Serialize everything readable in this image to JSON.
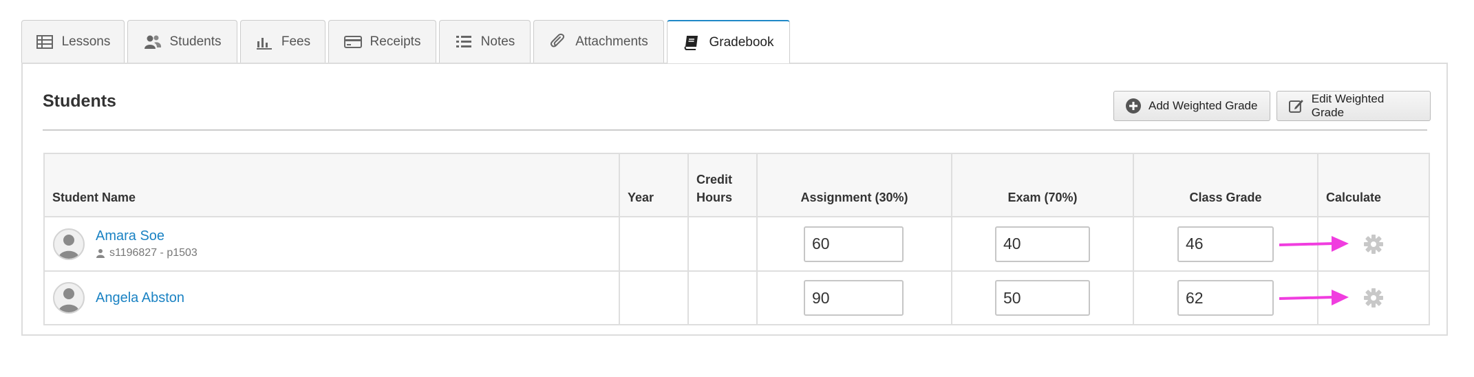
{
  "tabs": [
    {
      "label": "Lessons",
      "icon": "table-icon"
    },
    {
      "label": "Students",
      "icon": "users-icon"
    },
    {
      "label": "Fees",
      "icon": "bar-chart-icon"
    },
    {
      "label": "Receipts",
      "icon": "credit-card-icon"
    },
    {
      "label": "Notes",
      "icon": "list-icon"
    },
    {
      "label": "Attachments",
      "icon": "paperclip-icon"
    },
    {
      "label": "Gradebook",
      "icon": "book-icon",
      "active": true
    }
  ],
  "panel": {
    "title": "Students",
    "add_weighted_label": "Add Weighted Grade",
    "edit_weighted_label": "Edit Weighted Grade"
  },
  "table": {
    "headers": {
      "student_name": "Student Name",
      "year": "Year",
      "credit_hours": "Credit Hours",
      "assignment": "Assignment (30%)",
      "exam": "Exam (70%)",
      "class_grade": "Class Grade",
      "calculate": "Calculate"
    },
    "rows": [
      {
        "name": "Amara Soe",
        "meta": "s1196827 - p1503",
        "year": "",
        "credit_hours": "",
        "assignment": "60",
        "exam": "40",
        "class_grade": "46"
      },
      {
        "name": "Angela Abston",
        "meta": "",
        "year": "",
        "credit_hours": "",
        "assignment": "90",
        "exam": "50",
        "class_grade": "62"
      }
    ]
  },
  "colors": {
    "link": "#1a82c3",
    "active_tab_border": "#1e88c7",
    "annotation_arrow": "#f03ddf",
    "gear": "#c8c8c8"
  }
}
